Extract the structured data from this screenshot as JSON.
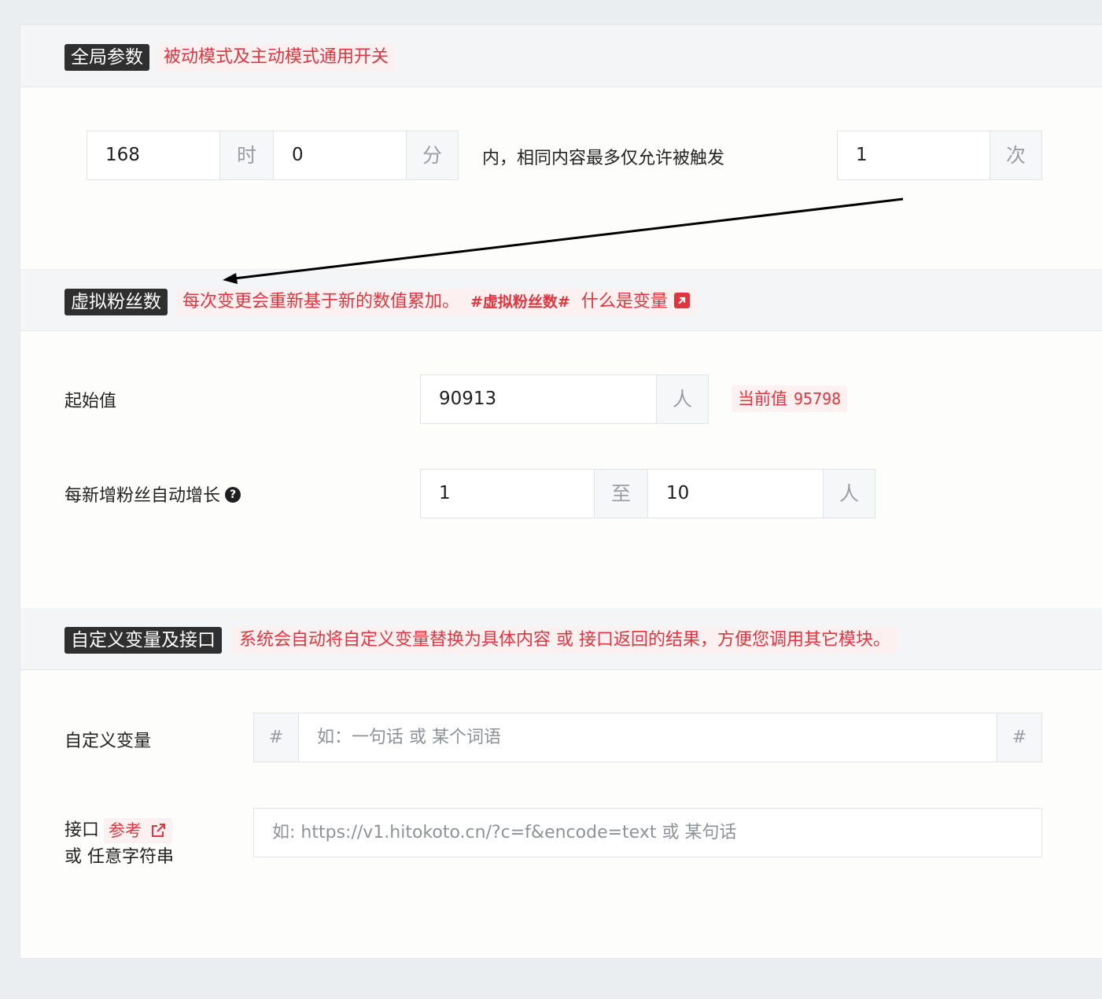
{
  "global": {
    "title": "全局参数",
    "hint": "被动模式及主动模式通用开关",
    "hours_value": "168",
    "hours_unit": "时",
    "minutes_value": "0",
    "minutes_unit": "分",
    "middle_text": "内，相同内容最多仅允许被触发",
    "times_value": "1",
    "times_unit": "次"
  },
  "virtual_fans": {
    "title": "虚拟粉丝数",
    "hint_text": "每次变更会重新基于新的数值累加。",
    "hint_tag": "#虚拟粉丝数#",
    "hint_link": "什么是变量",
    "start_label": "起始值",
    "start_value": "90913",
    "start_unit": "人",
    "current_label": "当前值",
    "current_value": "95798",
    "growth_label": "每新增粉丝自动增长",
    "growth_min": "1",
    "growth_sep": "至",
    "growth_max": "10",
    "growth_unit": "人"
  },
  "custom_vars": {
    "title": "自定义变量及接口",
    "hint": "系统会自动将自定义变量替换为具体内容 或 接口返回的结果，方便您调用其它模块。",
    "var_label": "自定义变量",
    "var_prefix": "#",
    "var_placeholder": "如：一句话 或 某个词语",
    "var_suffix": "#",
    "api_label": "接口",
    "api_ref": "参考",
    "api_label2": "或 任意字符串",
    "api_placeholder": "如: https://v1.hitokoto.cn/?c=f&encode=text 或 某句话"
  },
  "icons": {
    "help": "question-circle-icon",
    "external": "external-link-icon",
    "external_square": "external-link-square-icon"
  },
  "colors": {
    "accent_red": "#e0353e",
    "badge_dark": "#2f2f2f",
    "page_bg": "#ebeef1"
  }
}
